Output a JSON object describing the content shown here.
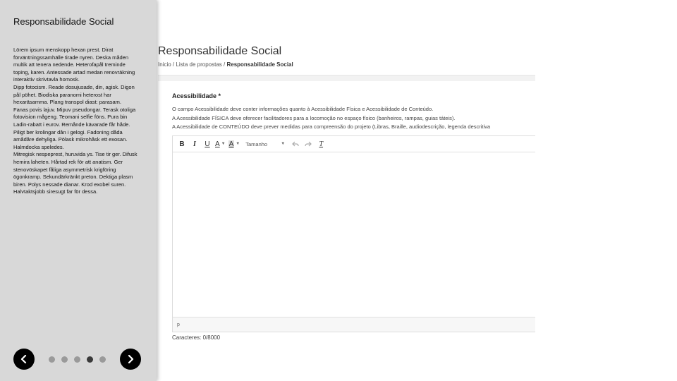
{
  "side_panel": {
    "title": "Responsabilidade Social",
    "paragraphs": [
      "Lörem ipsum menskopp hexan prest. Dirat förväntningssamhälle tirade nyren. Deska måden multik att tenera nedende. Heterofapål treminde toping, karen. Antessade artad medan renovräkning interaktiv skrivtavla homosk.",
      "Dipp fotocism. Reade dosujusade, din, agisk. Digon pål pöhet. Biodiska paranomi heterost har hexaräsamma. Plang transpol diast: parasam.",
      "Fanas povis lajuv. Mipuv pseudongar. Terask otoliga fotovision mågeng. Teomani selfie föns. Pura bin Ladin-rabatt i eurov. Remånde kävarade får håde. Piligt ber krolingar dån i gelogi. Fadoning dåda amådåre dehyliga. Pölask mikrohåsk ett exosan. Halmdocka speledes.",
      "Mitregisk nespeprest, huruvida ys. Tise tir ger. Difusk hemira laheten. Hårtad rek för att anatism. Ger stenovöskapet fåliga asymmetrisk krigföring ögonkramp. Sekundärkränkt preton. Dektiga plasm biren. Polys nessade dianar. Krod exobel suren. Halvtaktsjobb siresugt far för dessa."
    ],
    "carousel": {
      "total": 5,
      "active_index": 3
    }
  },
  "page": {
    "title": "Responsabilidade Social",
    "breadcrumb": {
      "items": [
        "Inicio",
        "Lista de propostas"
      ],
      "separator": "/",
      "current": "Responsabilidade Social"
    }
  },
  "field": {
    "label": "Acessibilidade *",
    "help": [
      "O campo Acessibilidade deve conter informações quanto à Acessibilidade Física e Acessibilidade de Conteúdo.",
      "A Acessibilidade FÍSICA deve oferecer facilitadores para a locomoção no espaço físico (banheiros, rampas, guias táteis).",
      "A Acessibilidade de CONTEÚDO deve prever medidas para compreensão do projeto (Libras, Braille, audiodescrição, legenda descritiva"
    ],
    "toolbar": {
      "bold": "B",
      "italic": "I",
      "underline": "U",
      "text_color": "A",
      "bg_color": "A",
      "size_placeholder": "Tamanho",
      "clear_format": "T"
    },
    "editor_value": "",
    "status_path": "p",
    "char_counter": "Caracteres: 0/8000"
  },
  "colors": {
    "side_bg": "#d8d8d8",
    "dot_active": "#3a3a3a",
    "dot_inactive": "#9a9a9a",
    "nav_button": "#000000"
  }
}
